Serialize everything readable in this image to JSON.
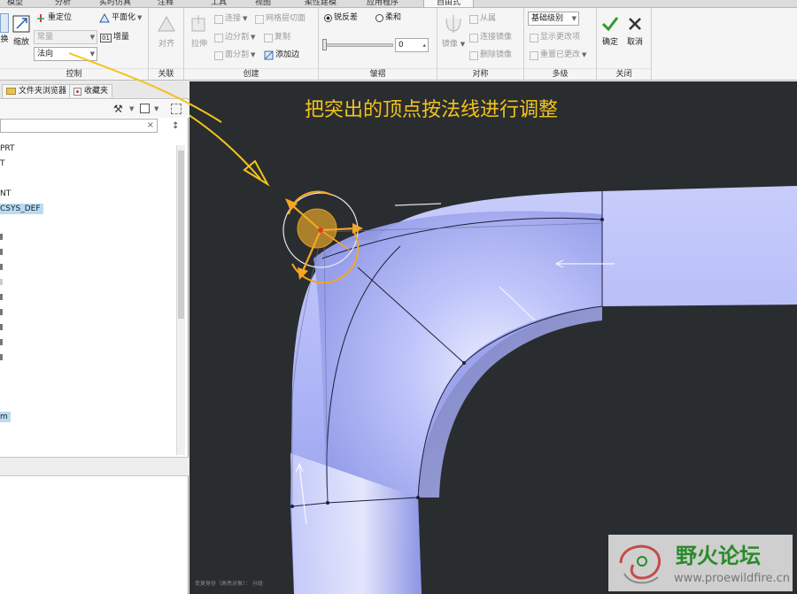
{
  "tabs": [
    {
      "label": "模型",
      "active": false
    },
    {
      "label": "分析",
      "active": false
    },
    {
      "label": "实时仿真",
      "active": false
    },
    {
      "label": "注释",
      "active": false
    },
    {
      "label": "工具",
      "active": false
    },
    {
      "label": "视图",
      "active": false
    },
    {
      "label": "柔性建模",
      "active": false
    },
    {
      "label": "应用程序",
      "active": false
    },
    {
      "label": "自由式",
      "active": true
    }
  ],
  "ribbon": {
    "control": {
      "group_label": "控制",
      "cut_label": "换",
      "scale_label": "缩放",
      "reposition_label": "重定位",
      "flatten_label": "平面化",
      "constant_combo": "常量",
      "increase_label": "增量",
      "normal_combo": "法向"
    },
    "relation": {
      "group_label": "关联",
      "align_label": "对齐"
    },
    "create": {
      "group_label": "创建",
      "extrude_label": "拉伸",
      "connect_label": "连接",
      "mesh_cut_label": "网格层切面",
      "edge_split_label": "边分割",
      "copy_label": "复制",
      "face_split_label": "面分割",
      "add_edge_label": "添加边"
    },
    "crease": {
      "group_label": "皱褶",
      "sharp_label": "锐反差",
      "soft_label": "柔和",
      "slider_value": "0"
    },
    "symmetry": {
      "group_label": "对称",
      "mirror_label": "镜像",
      "slave_label": "从属",
      "connect_mirror_label": "连接镜像",
      "delete_mirror_label": "删除镜像"
    },
    "multilevel": {
      "group_label": "多级",
      "level_combo": "基础级别",
      "show_changes_label": "显示更改项",
      "reset_changes_label": "重置已更改"
    },
    "close": {
      "group_label": "关闭",
      "ok_label": "确定",
      "cancel_label": "取消"
    }
  },
  "left_panel": {
    "tab_browser": "文件夹浏览器",
    "tab_favorites": "收藏夹",
    "tree": [
      {
        "label": "PRT",
        "selected": false
      },
      {
        "label": "T",
        "selected": false
      },
      {
        "label": "NT",
        "selected": false
      },
      {
        "label": "CSYS_DEF",
        "selected": true
      },
      {
        "label": "m",
        "selected": false
      }
    ]
  },
  "viewport": {
    "annotation": "把突出的顶点按法线进行调整",
    "status_text": "变更身份（高亮对象）：  分组"
  },
  "watermark": {
    "title": "野火论坛",
    "url": "www.proewildfire.cn"
  },
  "colors": {
    "viewport_bg": "#2a2d2f",
    "model_fill": "#a9b0f4",
    "annotation": "#f2c31c",
    "accent_orange": "#f5a623"
  }
}
